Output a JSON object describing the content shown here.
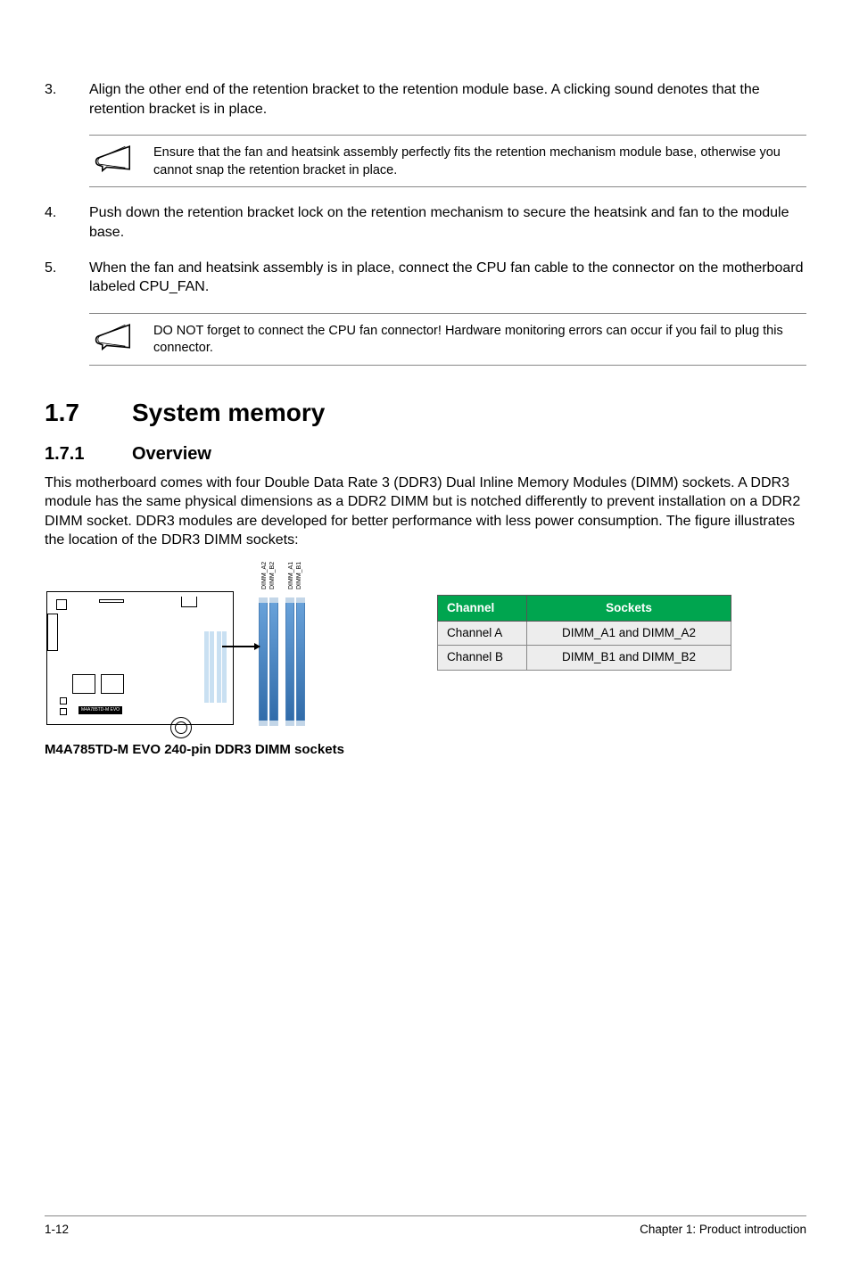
{
  "steps_a": {
    "3": {
      "num": "3.",
      "text": "Align the other end of the retention bracket to the retention module base. A clicking sound denotes that the retention bracket is in place."
    }
  },
  "note1": "Ensure that the fan and heatsink assembly perfectly fits the retention mechanism module base, otherwise you cannot snap the retention bracket  in place.",
  "steps_b": {
    "4": {
      "num": "4.",
      "text": "Push down the retention bracket lock on the retention mechanism to secure the heatsink and fan to the module base."
    },
    "5": {
      "num": "5.",
      "text": "When the fan and heatsink assembly is in place, connect the CPU fan cable to the connector on the motherboard labeled CPU_FAN."
    }
  },
  "note2": "DO NOT forget to connect the CPU fan connector! Hardware monitoring errors can occur if you fail to plug this connector.",
  "section": {
    "num": "1.7",
    "title": "System memory"
  },
  "subsection": {
    "num": "1.7.1",
    "title": "Overview"
  },
  "overview_p": "This motherboard comes with four Double Data Rate 3 (DDR3) Dual Inline Memory Modules (DIMM) sockets. A DDR3 module has the same physical dimensions as a DDR2 DIMM but is notched differently to prevent installation on a DDR2 DIMM socket. DDR3 modules are developed for better performance with less power consumption. The figure illustrates the location of the DDR3 DIMM sockets:",
  "dimm_labels": {
    "a2": "DIMM_A2",
    "b2": "DIMM_B2",
    "a1": "DIMM_A1",
    "b1": "DIMM_B1"
  },
  "board_model": "M4A785TD-M EVO",
  "caption": "M4A785TD-M EVO 240-pin DDR3 DIMM sockets",
  "table": {
    "h1": "Channel",
    "h2": "Sockets",
    "rows": [
      {
        "c": "Channel A",
        "s": "DIMM_A1 and DIMM_A2"
      },
      {
        "c": "Channel B",
        "s": "DIMM_B1 and DIMM_B2"
      }
    ]
  },
  "footer": {
    "left": "1-12",
    "right": "Chapter 1: Product introduction"
  }
}
